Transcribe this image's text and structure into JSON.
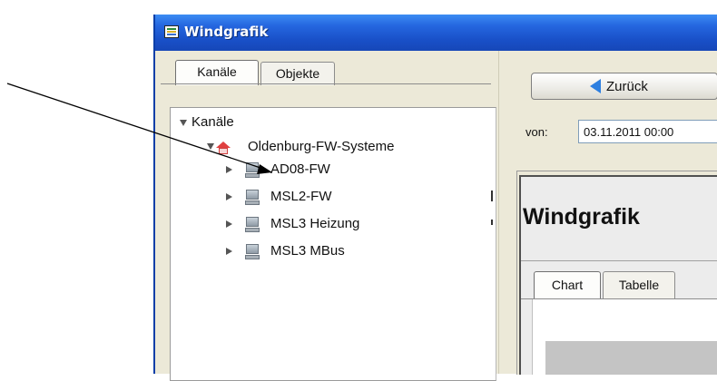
{
  "window": {
    "title": "Windgrafik"
  },
  "left_tabs": [
    {
      "label": "Kanäle",
      "active": true
    },
    {
      "label": "Objekte",
      "active": false
    }
  ],
  "tree": {
    "root": "Kanäle",
    "group": "Oldenburg-FW-Systeme",
    "items": [
      {
        "label": "AD08-FW"
      },
      {
        "label": "MSL2-FW"
      },
      {
        "label": "MSL3 Heizung"
      },
      {
        "label": "MSL3 MBus"
      }
    ]
  },
  "toolbar": {
    "back_label": "Zurück"
  },
  "range": {
    "from_label": "von:",
    "from_value": "03.11.2011 00:00"
  },
  "content": {
    "heading": "Windgrafik",
    "tabs": [
      {
        "label": "Chart",
        "active": true
      },
      {
        "label": "Tabelle",
        "active": false
      }
    ]
  },
  "icons": {
    "app": "app-window-icon",
    "back": "back-arrow-icon",
    "computer": "computer-icon",
    "house": "house-icon"
  },
  "colors": {
    "titlebar": "#2567e0",
    "back_arrow": "#2d7fe0",
    "house_roof": "#e04040"
  }
}
